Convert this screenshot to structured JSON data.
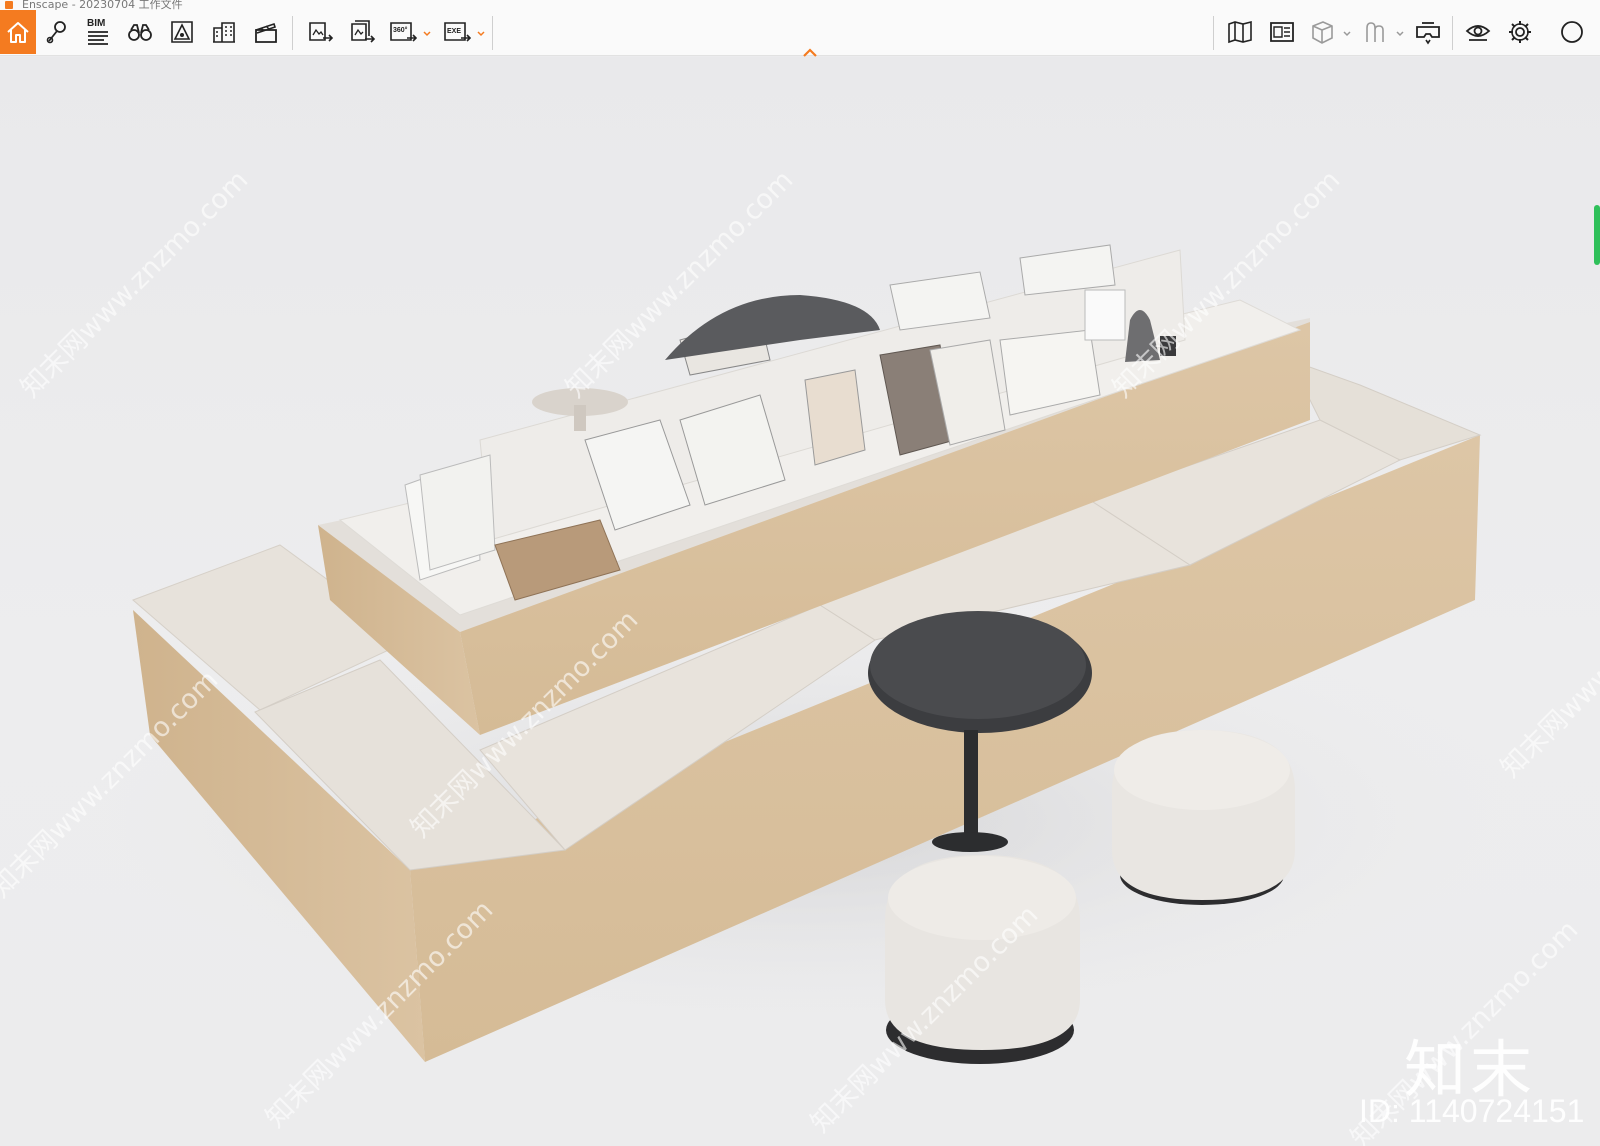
{
  "app": {
    "title": "Enscape - 20230704 工作文件"
  },
  "toolbar": {
    "left_group": [
      {
        "id": "home",
        "icon": "home-icon"
      },
      {
        "id": "views",
        "icon": "map-pin-icon"
      },
      {
        "id": "bim",
        "icon": "bim-list-icon",
        "label": "BIM"
      },
      {
        "id": "visual",
        "icon": "binoculars-icon"
      },
      {
        "id": "atmosphere",
        "icon": "atmosphere-icon"
      },
      {
        "id": "asset",
        "icon": "buildings-icon"
      },
      {
        "id": "video",
        "icon": "clapperboard-icon"
      }
    ],
    "export_group": [
      {
        "id": "screenshot",
        "icon": "export-image-icon"
      },
      {
        "id": "batch",
        "icon": "batch-export-icon"
      },
      {
        "id": "pano",
        "icon": "panorama-360-icon",
        "label": "360°"
      },
      {
        "id": "exe",
        "icon": "export-exe-icon",
        "label": "EXE"
      }
    ],
    "right_group": [
      {
        "id": "map",
        "icon": "map-book-icon"
      },
      {
        "id": "minimap",
        "icon": "minimap-icon"
      },
      {
        "id": "cube",
        "icon": "cube-icon"
      },
      {
        "id": "people",
        "icon": "people-icon"
      },
      {
        "id": "vr",
        "icon": "vr-headset-icon"
      },
      {
        "id": "visibility",
        "icon": "eye-icon"
      },
      {
        "id": "settings",
        "icon": "gear-icon"
      }
    ],
    "accent_color": "#f47b20"
  },
  "watermark": {
    "text": "知末网www.znzmo.com",
    "brand": "知末",
    "image_id": "ID: 1140724151"
  }
}
